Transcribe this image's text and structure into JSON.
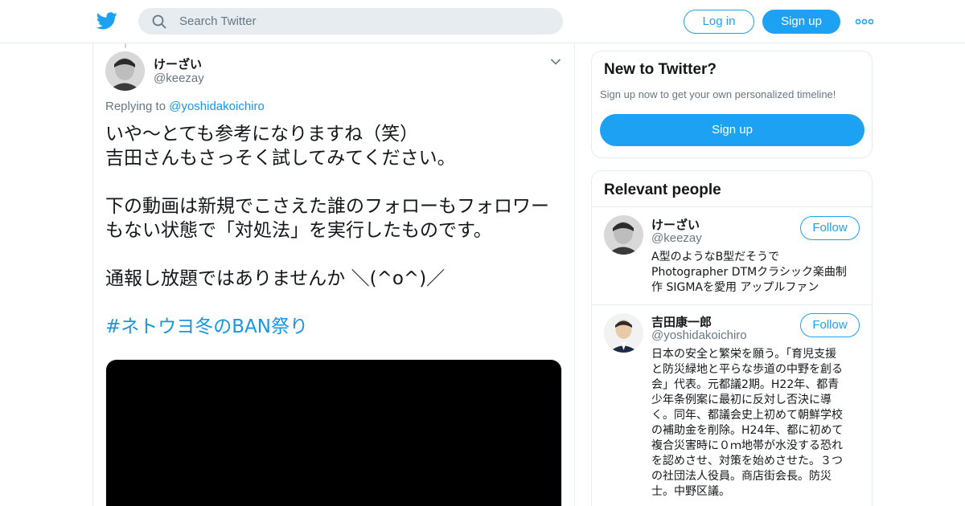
{
  "header": {
    "logo_icon": "twitter-bird-icon",
    "search_placeholder": "Search Twitter",
    "login_label": "Log in",
    "signup_label": "Sign up",
    "more_icon": "more-dots-icon",
    "brand_color": "#1da1f2"
  },
  "tweet": {
    "author_name": "けーざい",
    "author_handle": "@keezay",
    "replying_prefix": "Replying to",
    "replying_to": "@yoshidakoichiro",
    "lines": [
      "いや〜とても参考になりますね（笑）",
      "吉田さんもさっそく試してみてください。",
      "下の動画は新規でこさえた誰のフォローもフォロワー",
      "もない状態で「対処法」を実行したものです。",
      "通報し放題ではありませんか ＼(^o^)／",
      "#ネトウヨ冬のBAN祭り"
    ],
    "link_color": "#1b95e0"
  },
  "sidebar": {
    "new_card": {
      "title": "New to Twitter?",
      "subtitle": "Sign up now to get your own personalized timeline!",
      "signup_label": "Sign up"
    },
    "relevant": {
      "title": "Relevant people",
      "people": [
        {
          "name": "けーざい",
          "handle": "@keezay",
          "follow_label": "Follow",
          "bio_lines": [
            "A型のようなB型だそうで",
            "Photographer DTMクラシック楽曲制",
            "作 SIGMAを愛用 アップルファン"
          ]
        },
        {
          "name": "吉田康一郎",
          "handle": "@yoshidakoichiro",
          "follow_label": "Follow",
          "bio_lines": [
            "日本の安全と繁栄を願う。「育児支援",
            "と防災緑地と平らな歩道の中野を創る",
            "会」代表。元都議2期。H22年、都青",
            "少年条例案に最初に反対し否決に導",
            "く。同年、都議会史上初めて朝鮮学校",
            "の補助金を削除。H24年、都に初めて",
            "複合災害時に０ｍ地帯が水没する恐れ",
            "を認めさせ、対策を始めさせた。３つ",
            "の社団法人役員。商店街会長。防災",
            "士。中野区議。"
          ]
        }
      ]
    }
  }
}
